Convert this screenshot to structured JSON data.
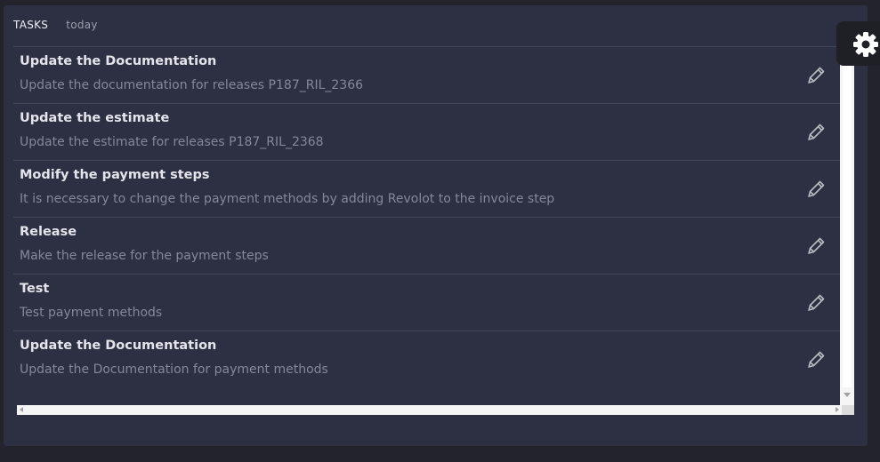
{
  "tabs": [
    {
      "label": "TASKS",
      "active": true
    },
    {
      "label": "today",
      "active": false
    }
  ],
  "tasks": [
    {
      "title": "Update the Documentation",
      "description": "Update the documentation for releases P187_RIL_2366"
    },
    {
      "title": "Update the estimate",
      "description": "Update the estimate for releases P187_RIL_2368"
    },
    {
      "title": "Modify the payment steps",
      "description": "It is necessary to change the payment methods by adding Revolot to the invoice step"
    },
    {
      "title": "Release",
      "description": "Make the release for the payment steps"
    },
    {
      "title": "Test",
      "description": "Test payment methods"
    },
    {
      "title": "Update the Documentation",
      "description": "Update the Documentation for payment methods"
    }
  ],
  "icons": {
    "edit": "pencil-icon",
    "settings": "gear-icon"
  },
  "colors": {
    "background": "#23232b",
    "panel": "#2d2f42",
    "title_text": "#e4e5ec",
    "description_text": "#858899",
    "divider": "#424659"
  }
}
